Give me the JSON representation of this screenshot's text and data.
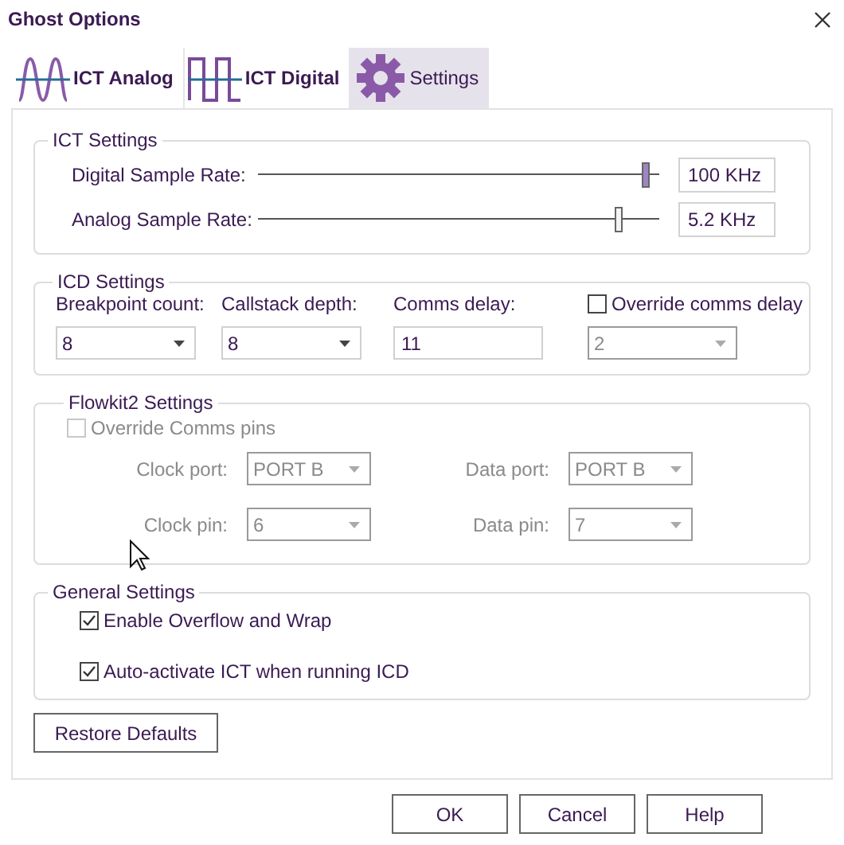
{
  "window": {
    "title": "Ghost Options"
  },
  "tabs": [
    {
      "label": "ICT Analog",
      "kind": "analog",
      "selected": false
    },
    {
      "label": "ICT Digital",
      "kind": "digital",
      "selected": false
    },
    {
      "label": "Settings",
      "kind": "gear",
      "selected": true
    }
  ],
  "ict_settings": {
    "title": "ICT Settings",
    "sliders": [
      {
        "label": "Digital Sample Rate:",
        "level": 0.97,
        "reading": "100 KHz"
      },
      {
        "label": "Analog Sample Rate:",
        "level": 0.9,
        "reading": "5.2 KHz"
      }
    ]
  },
  "icd_settings": {
    "title": "ICD Settings",
    "fields": [
      {
        "kind": "dropdown",
        "label": "Breakpoint count:",
        "value": "8",
        "disabled": false
      },
      {
        "kind": "dropdown",
        "label": "Callstack depth:",
        "value": "8",
        "disabled": false
      },
      {
        "kind": "text",
        "label": "Comms delay:",
        "value": "11",
        "disabled": false
      },
      {
        "kind": "check-dropdown",
        "label": "Override comms delay",
        "checked": false,
        "value": "2",
        "disabled": true
      }
    ]
  },
  "flowkit2_settings": {
    "title": "Flowkit2 Settings",
    "disabled": true,
    "override": {
      "label": "Override Comms pins",
      "checked": false
    },
    "fields": [
      {
        "label": "Clock port:",
        "value": "PORT B"
      },
      {
        "label": "Data port:",
        "value": "PORT B"
      },
      {
        "label": "Clock pin:",
        "value": "6"
      },
      {
        "label": "Data pin:",
        "value": "7"
      }
    ]
  },
  "general_settings": {
    "title": "General Settings",
    "options": [
      {
        "label": "Enable Overflow and Wrap",
        "checked": true
      },
      {
        "label": "Auto-activate ICT when running ICD",
        "checked": true
      }
    ]
  },
  "restore_button": "Restore Defaults",
  "buttons": [
    "OK",
    "Cancel",
    "Help"
  ]
}
